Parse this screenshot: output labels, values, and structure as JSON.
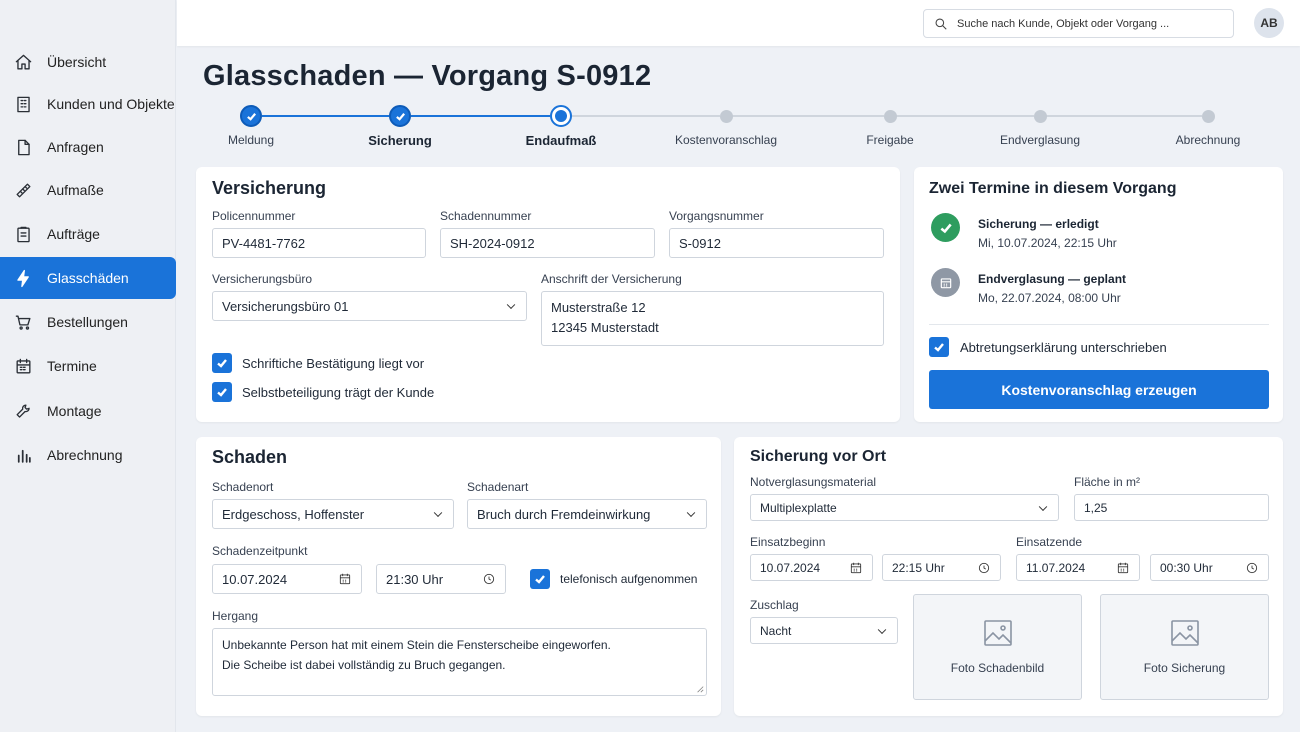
{
  "sidebar": {
    "items": [
      {
        "label": "Übersicht",
        "icon": "home-icon"
      },
      {
        "label": "Kunden und Objekte",
        "icon": "building-icon"
      },
      {
        "label": "Anfragen",
        "icon": "document-icon"
      },
      {
        "label": "Aufmaße",
        "icon": "ruler-icon"
      },
      {
        "label": "Aufträge",
        "icon": "clipboard-icon"
      },
      {
        "label": "Glasschäden",
        "icon": "lightning-icon",
        "active": true
      },
      {
        "label": "Bestellungen",
        "icon": "cart-icon"
      },
      {
        "label": "Termine",
        "icon": "calendar-icon"
      },
      {
        "label": "Montage",
        "icon": "wrench-icon"
      },
      {
        "label": "Abrechnung",
        "icon": "bar-chart-icon"
      }
    ]
  },
  "header": {
    "search_placeholder": "Suche nach Kunde, Objekt oder Vorgang ...",
    "avatar_initials": "AB"
  },
  "page": {
    "title": "Glasschaden — Vorgang S-0912"
  },
  "stepper": {
    "steps": [
      {
        "label": "Meldung",
        "state": "done"
      },
      {
        "label": "Sicherung",
        "state": "done"
      },
      {
        "label": "Endaufmaß",
        "state": "current"
      },
      {
        "label": "Kostenvoranschlag",
        "state": "todo"
      },
      {
        "label": "Freigabe",
        "state": "todo"
      },
      {
        "label": "Endverglasung",
        "state": "todo"
      },
      {
        "label": "Abrechnung",
        "state": "todo"
      }
    ]
  },
  "versicherung": {
    "title": "Versicherung",
    "policennummer_label": "Policennummer",
    "policennummer_value": "PV-4481-7762",
    "schadennummer_label": "Schadennummer",
    "schadennummer_value": "SH-2024-0912",
    "vorgangsnummer_label": "Vorgangsnummer",
    "vorgangsnummer_value": "S-0912",
    "buero_label": "Versicherungsbüro",
    "buero_value": "Versicherungsbüro 01",
    "anschrift_label": "Anschrift der Versicherung",
    "anschrift_line1": "Musterstraße 12",
    "anschrift_line2": "12345 Musterstadt",
    "cb1_label": "Schriftiche Bestätigung liegt vor",
    "cb2_label": "Selbstbeteiligung trägt der Kunde"
  },
  "termine": {
    "title": "Zwei Termine in diesem Vorgang",
    "t1_title": "Sicherung — erledigt",
    "t1_date": "Mi, 10.07.2024, 22:15 Uhr",
    "t2_title": "Endverglasung — geplant",
    "t2_date": "Mo, 22.07.2024, 08:00 Uhr",
    "cb_label": "Abtretungserklärung unterschrieben",
    "button_label": "Kostenvoranschlag erzeugen"
  },
  "schaden": {
    "title": "Schaden",
    "ort_label": "Schadenort",
    "ort_value": "Erdgeschoss, Hoffenster",
    "art_label": "Schadenart",
    "art_value": "Bruch durch Fremdeinwirkung",
    "zeit_label": "Schadenzeitpunkt",
    "datum_value": "10.07.2024",
    "uhrzeit_value": "21:30 Uhr",
    "telefonisch_label": "telefonisch aufgenommen",
    "hergang_label": "Hergang",
    "hergang_line1": "Unbekannte Person hat mit einem Stein die Fensterscheibe eingeworfen.",
    "hergang_line2": "Die Scheibe ist dabei vollständig zu Bruch gegangen."
  },
  "sicherung": {
    "title": "Sicherung vor Ort",
    "material_label": "Notverglasungsmaterial",
    "material_value": "Multiplexplatte",
    "flaeche_label": "Fläche in m²",
    "flaeche_value": "1,25",
    "beginn_label": "Einsatzbeginn",
    "beginn_datum": "10.07.2024",
    "beginn_zeit": "22:15 Uhr",
    "ende_label": "Einsatzende",
    "ende_datum": "11.07.2024",
    "ende_zeit": "00:30 Uhr",
    "zuschlag_label": "Zuschlag",
    "zuschlag_value": "Nacht",
    "foto1_label": "Foto Schadenbild",
    "foto2_label": "Foto Sicherung"
  }
}
